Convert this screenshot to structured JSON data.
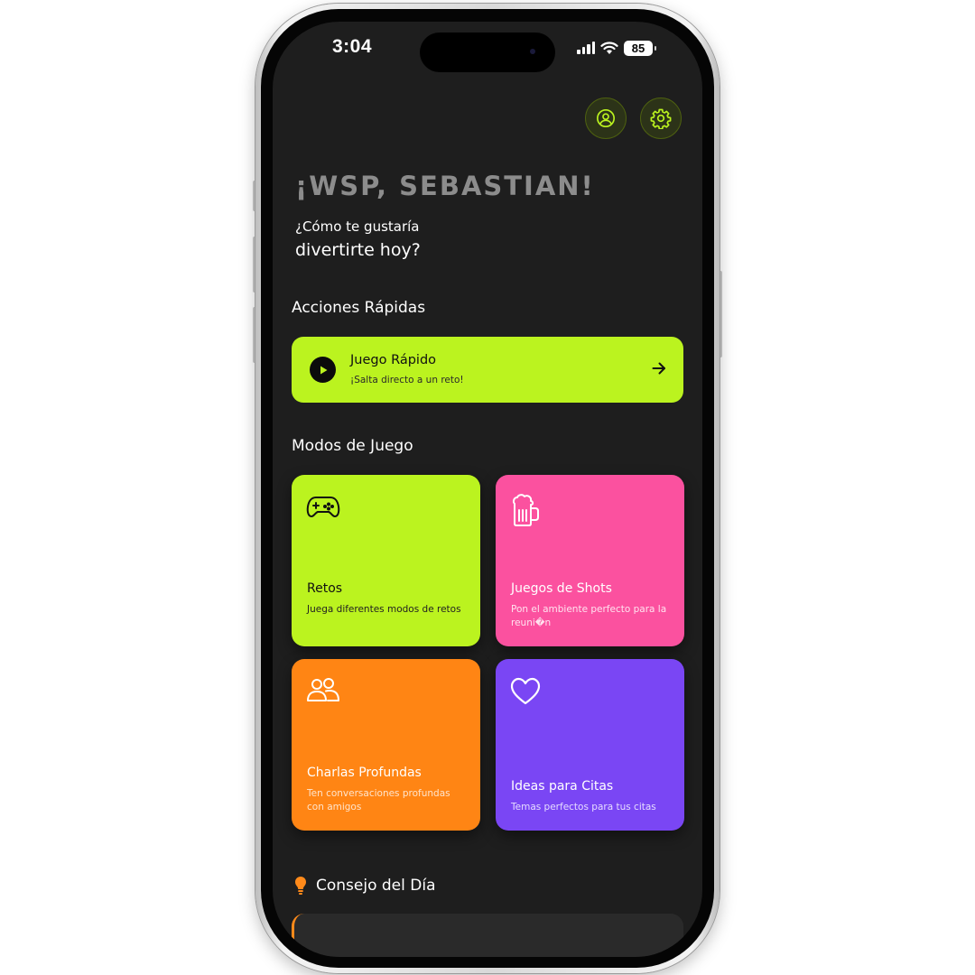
{
  "status_bar": {
    "time": "3:04",
    "battery": "85"
  },
  "header": {
    "greeting": "¡WSP, SEBASTIAN!",
    "subtitle_line1": "¿Cómo te gustaría",
    "subtitle_line2": "divertirte hoy?",
    "profile_icon": "profile-icon",
    "settings_icon": "gear-icon"
  },
  "quick_actions": {
    "section_title": "Acciones Rápidas",
    "card": {
      "title": "Juego Rápido",
      "subtitle": "¡Salta directo a un reto!",
      "icon": "play-icon",
      "arrow": "arrow-right-icon"
    }
  },
  "game_modes": {
    "section_title": "Modos de Juego",
    "cards": [
      {
        "title": "Retos",
        "description": "Juega diferentes modos de retos",
        "icon": "gamepad-icon",
        "color": "#bbf31f",
        "text_color": "#111111"
      },
      {
        "title": "Juegos de Shots",
        "description": "Pon el ambiente perfecto para la reuni�n",
        "icon": "beer-mug-icon",
        "color": "#fb519f",
        "text_color": "#ffffff"
      },
      {
        "title": "Charlas Profundas",
        "description": "Ten conversaciones profundas con amigos",
        "icon": "users-icon",
        "color": "#ff8514",
        "text_color": "#ffffff"
      },
      {
        "title": "Ideas para Citas",
        "description": "Temas perfectos para tus citas",
        "icon": "heart-icon",
        "color": "#7a46f4",
        "text_color": "#ffffff"
      }
    ]
  },
  "tip": {
    "section_title": "Consejo del Día",
    "icon": "lightbulb-icon",
    "accent": "#ff8a1a"
  },
  "colors": {
    "background": "#1e1e1e",
    "accent": "#bbf31f"
  }
}
